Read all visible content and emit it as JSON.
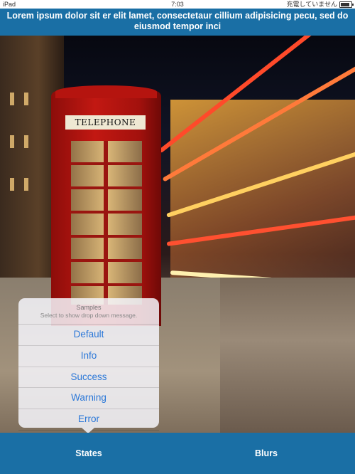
{
  "status_bar": {
    "device": "iPad",
    "time": "7:03",
    "charging_text": "充電していません",
    "battery_level": 0.85,
    "wifi_icon": "wifi-icon",
    "battery_icon": "battery-icon"
  },
  "banner": {
    "message": "Lorem ipsum dolor sit er elit lamet, consectetaur cillium adipisicing pecu, sed do eiusmod tempor inci"
  },
  "photo": {
    "sign_text": "TELEPHONE"
  },
  "popover": {
    "title": "Samples",
    "subtitle": "Select to show drop down message.",
    "items": [
      {
        "label": "Default"
      },
      {
        "label": "Info"
      },
      {
        "label": "Success"
      },
      {
        "label": "Warning"
      },
      {
        "label": "Error"
      }
    ]
  },
  "toolbar": {
    "states_label": "States",
    "blurs_label": "Blurs"
  },
  "colors": {
    "accent": "#1a6fa5",
    "link_blue": "#2b78d8"
  }
}
